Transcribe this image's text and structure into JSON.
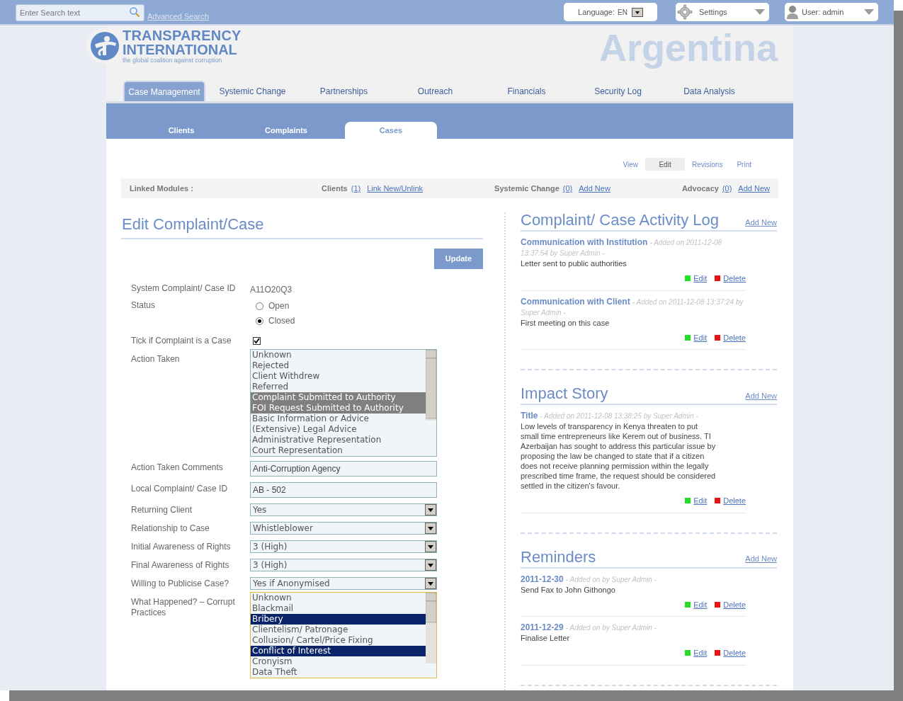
{
  "top_bar": {
    "search": {
      "placeholder": "Enter Search text"
    },
    "advanced_search": "Advanced Search",
    "language": {
      "label": "Language:",
      "value": "EN"
    },
    "settings": "Settings",
    "user": "User: admin"
  },
  "logo": {
    "line_1": "TRANSPARENCY",
    "line_2": "INTERNATIONAL",
    "tagline": "the global coalition against corruption"
  },
  "country": "Argentina",
  "main_tabs": [
    {
      "label": "Case Management",
      "selected": true
    },
    {
      "label": "Systemic Change",
      "selected": false
    },
    {
      "label": "Partnerships",
      "selected": false
    },
    {
      "label": "Outreach",
      "selected": false
    },
    {
      "label": "Financials",
      "selected": false
    },
    {
      "label": "Security Log",
      "selected": false
    },
    {
      "label": "Data Analysis",
      "selected": false
    }
  ],
  "sub_tabs": [
    {
      "label": "Clients",
      "selected": false
    },
    {
      "label": "Complaints",
      "selected": false
    },
    {
      "label": "Cases",
      "selected": true
    }
  ],
  "view_tabs": [
    {
      "label": "View",
      "selected": false
    },
    {
      "label": "Edit",
      "selected": true
    },
    {
      "label": "Revisions",
      "selected": false
    },
    {
      "label": "Print",
      "selected": false
    }
  ],
  "linked_modules": {
    "label": "Linked Modules :",
    "items": [
      {
        "name": "Clients",
        "count": "(1)",
        "link": "Link New/Unlink"
      },
      {
        "name": "Systemic Change",
        "count": "(0)",
        "link": "Add New"
      },
      {
        "name": "Advocacy",
        "count": "(0)",
        "link": "Add New"
      }
    ]
  },
  "form": {
    "title": "Edit Complaint/Case",
    "update_button": "Update",
    "fields": [
      {
        "kind": "text",
        "label": "System Complaint/ Case ID",
        "value": "A11O20Q3"
      },
      {
        "kind": "radio",
        "label": "Status",
        "options": [
          {
            "label": "Open",
            "selected": false
          },
          {
            "label": "Closed",
            "selected": true
          }
        ]
      },
      {
        "kind": "checkbox",
        "label": "Tick if Complaint is a Case",
        "checked": true
      },
      {
        "kind": "listbox",
        "label": "Action Taken",
        "focused": false,
        "options": [
          {
            "label": "Unknown",
            "selected": false
          },
          {
            "label": "Rejected",
            "selected": false
          },
          {
            "label": "Client Withdrew",
            "selected": false
          },
          {
            "label": "Referred",
            "selected": false
          },
          {
            "label": "Complaint Submitted to Authority",
            "selected": true
          },
          {
            "label": "FOI Request Submitted to Authority",
            "selected": true
          },
          {
            "label": "Basic Information or Advice",
            "selected": false
          },
          {
            "label": "(Extensive) Legal Advice",
            "selected": false
          },
          {
            "label": "Administrative Representation",
            "selected": false
          },
          {
            "label": "Court Representation",
            "selected": false
          }
        ]
      },
      {
        "kind": "input",
        "label": "Action Taken Comments",
        "value": "Anti-Corruption Agency"
      },
      {
        "kind": "input",
        "label": "Local Complaint/ Case ID",
        "value": "AB - 502"
      },
      {
        "kind": "select",
        "label": "Returning Client",
        "value": "Yes"
      },
      {
        "kind": "select",
        "label": "Relationship to Case",
        "value": "Whistleblower"
      },
      {
        "kind": "select",
        "label": "Initial Awareness of Rights",
        "value": "3 (High)"
      },
      {
        "kind": "select",
        "label": "Final Awareness of Rights",
        "value": "3 (High)"
      },
      {
        "kind": "select",
        "label": "Willing to Publicise Case?",
        "value": "Yes if Anonymised"
      },
      {
        "kind": "listbox",
        "label": "What Happened? – Corrupt Practices",
        "focused": true,
        "options": [
          {
            "label": "Unknown",
            "selected": false
          },
          {
            "label": "Blackmail",
            "selected": false
          },
          {
            "label": "Bribery",
            "selected": true
          },
          {
            "label": "Clientelism/ Patronage",
            "selected": false
          },
          {
            "label": "Collusion/ Cartel/Price Fixing",
            "selected": false
          },
          {
            "label": "Conflict of Interest",
            "selected": true
          },
          {
            "label": "Cronyism",
            "selected": false
          },
          {
            "label": "Data Theft",
            "selected": false
          }
        ]
      }
    ]
  },
  "sections": [
    {
      "title": "Complaint/ Case Activity Log",
      "add_new": "Add New",
      "entries": [
        {
          "title": "Communication with Institution",
          "meta": "- Added on 2011-12-08 13:37:54 by Super Admin -",
          "text": "Letter sent to public authorities",
          "edit": "Edit",
          "delete": "Delete"
        },
        {
          "title": "Communication with Client",
          "meta": "- Added on 2011-12-08 13:37:24 by Super Admin -",
          "text": "First meeting on this case",
          "edit": "Edit",
          "delete": "Delete"
        }
      ]
    },
    {
      "title": "Impact Story",
      "add_new": "Add New",
      "entries": [
        {
          "title": "Title",
          "meta": "- Added on 2011-12-08 13:38:25 by Super Admin -",
          "text": "Low levels of transparency in Kenya threaten to put small time entrepreneurs like Kerem out of business. TI Azerbaijan has sought to address this particular issue by proposing the law be changed to state that if a citizen does not receive planning permission within the legally prescribed time frame, the request should be considered settled in the citizen's favour.",
          "edit": "Edit",
          "delete": "Delete"
        }
      ]
    },
    {
      "title": "Reminders",
      "add_new": "Add New",
      "entries": [
        {
          "title": "2011-12-30",
          "meta": "- Added on by Super Admin -",
          "text": "Send Fax to John Githongo",
          "edit": "Edit",
          "delete": "Delete"
        },
        {
          "title": "2011-12-29",
          "meta": "- Added on by Super Admin -",
          "text": "Finalise Letter",
          "edit": "Edit",
          "delete": "Delete"
        }
      ]
    }
  ]
}
